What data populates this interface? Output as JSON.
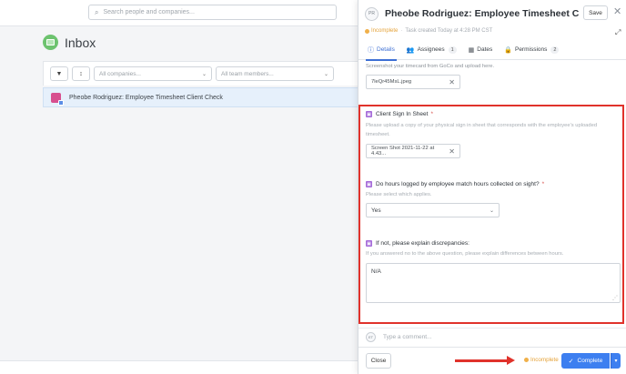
{
  "search": {
    "placeholder": "Search people and companies..."
  },
  "inbox": {
    "title": "Inbox",
    "filters": {
      "companies_placeholder": "All companies...",
      "team_placeholder": "All team members..."
    },
    "task_row": {
      "title": "Pheobe Rodriguez: Employee Timesheet Client Check"
    }
  },
  "panel": {
    "avatar_initials": "PR",
    "title": "Pheobe Rodriguez: Employee Timesheet Clie...",
    "save_label": "Save",
    "status": "Incomplete",
    "created": "Task created Today at 4:28 PM CST",
    "tabs": [
      {
        "label": "Details",
        "count": ""
      },
      {
        "label": "Assignees",
        "count": "1"
      },
      {
        "label": "Dates",
        "count": ""
      },
      {
        "label": "Permissions",
        "count": "2"
      }
    ],
    "prev_description": "Screenshot your timecard from GoCo and upload here.",
    "prev_file": "7leQr45MsL.jpeg",
    "questions": {
      "sign_in": {
        "label": "Client Sign In Sheet",
        "required": "*",
        "description": "Please upload a copy of your physical sign in sheet that corresponds with the employee's uploaded timesheet.",
        "file": "Screen Shot 2021-11-22 at 4.43..."
      },
      "hours_match": {
        "label": "Do hours logged by employee match hours collected on sight?",
        "required": "*",
        "description": "Please select which applies.",
        "value": "Yes"
      },
      "discrepancies": {
        "label": "If not, please explain discrepancies:",
        "description": "If you answered no to the above question, please explain differences between hours.",
        "value": "N/A"
      }
    },
    "comment": {
      "avatar_initials": "ET",
      "placeholder": "Type a comment..."
    },
    "footer": {
      "close_label": "Close",
      "status": "Incomplete",
      "complete_label": "Complete"
    }
  },
  "colors": {
    "accent": "#3d7ff0",
    "incomplete": "#e5a33a",
    "highlight": "#e0322b"
  }
}
